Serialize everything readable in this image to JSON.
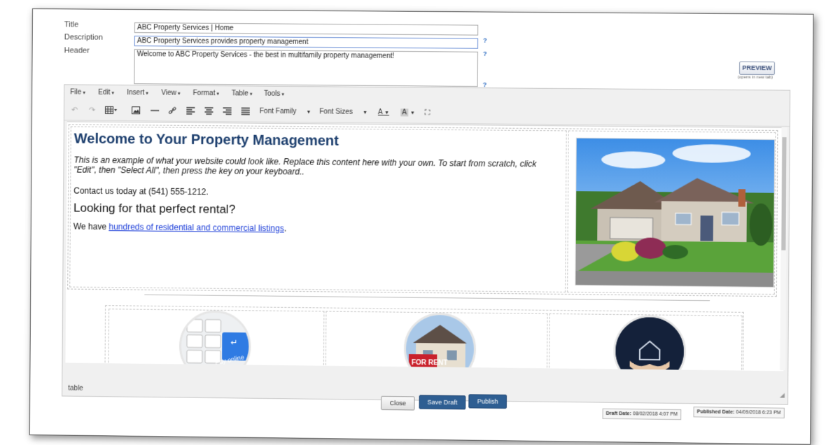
{
  "form": {
    "title_label": "Title",
    "title_value": "ABC Property Services | Home",
    "description_label": "Description",
    "description_value": "ABC Property Services provides property management",
    "header_label": "Header",
    "header_value": "Welcome to ABC Property Services - the best in multifamily property management!",
    "help_mark": "?"
  },
  "preview": {
    "label": "PREVIEW",
    "note": "(opens in new tab)"
  },
  "editor": {
    "menus": [
      "File",
      "Edit",
      "Insert",
      "View",
      "Format",
      "Table",
      "Tools"
    ],
    "font_family": "Font Family",
    "font_sizes": "Font Sizes",
    "statusbar": "table",
    "content": {
      "heading": "Welcome to Your Property Management",
      "intro": "This is an example of what your website could look like. Replace this content here with your own. To start from scratch, click \"Edit\", then \"Select All\", then press the  key on your keyboard..",
      "contact": "Contact us today at (541) 555-1212.",
      "subheading": "Looking for that perfect rental?",
      "listing_prefix": "We have ",
      "listing_link": "hundreds of residential and commercial listings",
      "listing_suffix": ".",
      "pay_online": "Pay online",
      "for_rent": "FOR RENT"
    }
  },
  "actions": {
    "close": "Close",
    "save_draft": "Save Draft",
    "publish": "Publish"
  },
  "dates": {
    "draft_label": "Draft Date:",
    "draft_value": "08/02/2018 4:07 PM",
    "published_label": "Published Date:",
    "published_value": "04/09/2018 6:23 PM"
  }
}
